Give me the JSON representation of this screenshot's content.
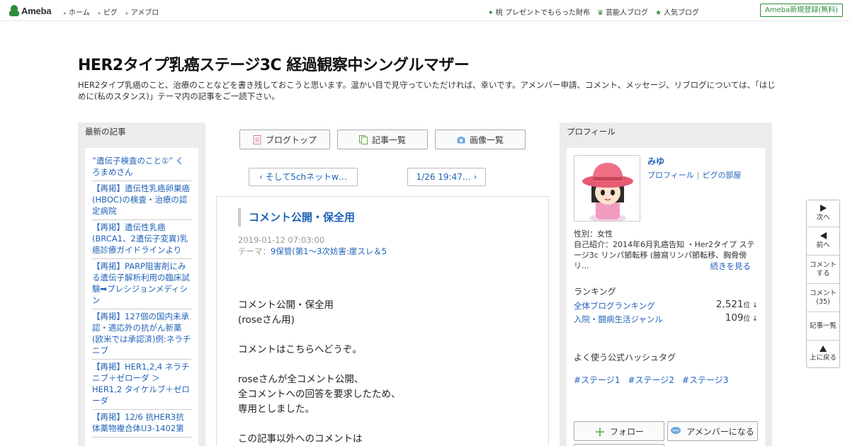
{
  "topbar": {
    "logo": "Ameba",
    "nav": [
      "ホーム",
      "ピグ",
      "アメブロ"
    ],
    "right_links": [
      {
        "icon": "sparkle-icon",
        "label": "桃 プレゼントでもらった財布"
      },
      {
        "icon": "crown-icon",
        "label": "芸能人ブログ"
      },
      {
        "icon": "star-icon",
        "label": "人気ブログ"
      }
    ],
    "register": "Ameba新規登録(無料)"
  },
  "header": {
    "title": "HER2タイプ乳癌ステージ3C 経過観察中シングルマザー",
    "description": "HER2タイプ乳癌のこと、治療のことなどを書き残しておこうと思います。温かい目で見守っていただければ、幸いです。アメンバー申請、コメント、メッセージ、リブログについては、「はじめに(私のスタンス)」テーマ内の記事をご一読下さい。"
  },
  "recent": {
    "heading": "最新の記事",
    "items": [
      "”遺伝子検査のこと①” くろまめさん",
      "【再掲】遺伝性乳癌卵巣癌(HBOC)の検査・治療の認定病院",
      "【再掲】遺伝性乳癌(BRCA1、2遺伝子変異)乳癌診療ガイドラインより",
      "【再掲】PARP阻害剤にみる遺伝子解析利用の臨床試験➡プレシジョンメディシン",
      "【再掲】127個の国内未承認・適応外の抗がん新薬(欧米では承認済)例:ネラチニブ",
      "【再掲】HER1,2,4 ネラチニブ＋ゼローダ ＞ HER1,2 タイケルブ＋ゼローダ",
      "【再掲】12/6 抗HER3抗体薬物複合体U3-1402第"
    ]
  },
  "center": {
    "nav_buttons": [
      {
        "icon": "blog-top-icon",
        "label": "ブログトップ"
      },
      {
        "icon": "article-list-icon",
        "label": "記事一覧"
      },
      {
        "icon": "camera-icon",
        "label": "画像一覧"
      }
    ],
    "prev_link": "そして5chネットw…",
    "next_link": "1/26 19:47…",
    "entry": {
      "title": "コメント公開・保全用",
      "date": "2019-01-12 07:03:00",
      "theme_label": "テーマ：",
      "theme": "9保管(第1～3次妨害:崖スレ＆5",
      "body": [
        "コメント公開・保全用",
        "(roseさん用)",
        "",
        "コメントはこちらへどうぞ。",
        "",
        "roseさんが全コメント公開、",
        "全コメントへの回答を要求したため、",
        "専用としました。",
        "",
        "この記事以外へのコメントは"
      ]
    }
  },
  "profile": {
    "heading": "プロフィール",
    "name": "みゆ",
    "link_profile": "プロフィール",
    "link_pig": "ピグの部屋",
    "gender": "性別：女性",
    "intro": "自己紹介：2014年6月乳癌告知 ・Her2タイプ ステージ3c リンパ節転移 (腋窩リンパ節転移、胸骨傍リ...",
    "read_more": "続きを見る",
    "ranking_heading": "ランキング",
    "rankings": [
      {
        "label": "全体ブログランキング",
        "value": "2,521",
        "unit": "位 ↓"
      },
      {
        "label": "入院・闘病生活ジャンル",
        "value": "109",
        "unit": "位 ↓"
      }
    ],
    "hashtag_heading": "よく使う公式ハッシュタグ",
    "hashtags": [
      "#ステージ1",
      "#ステージ2",
      "#ステージ3"
    ],
    "follow": "フォロー",
    "amember": "アメンバーになる"
  },
  "floatnav": {
    "next": "次へ",
    "prev": "前へ",
    "comment_line1": "コメント",
    "comment_line2": "する",
    "comments_line1": "コメント",
    "comments_line2": "(35)",
    "list": "記事一覧",
    "top": "上に戻る"
  },
  "colors": {
    "link": "#1f62b8",
    "ameba_green": "#2d8c3c",
    "sidebar_bg": "#ececec"
  }
}
